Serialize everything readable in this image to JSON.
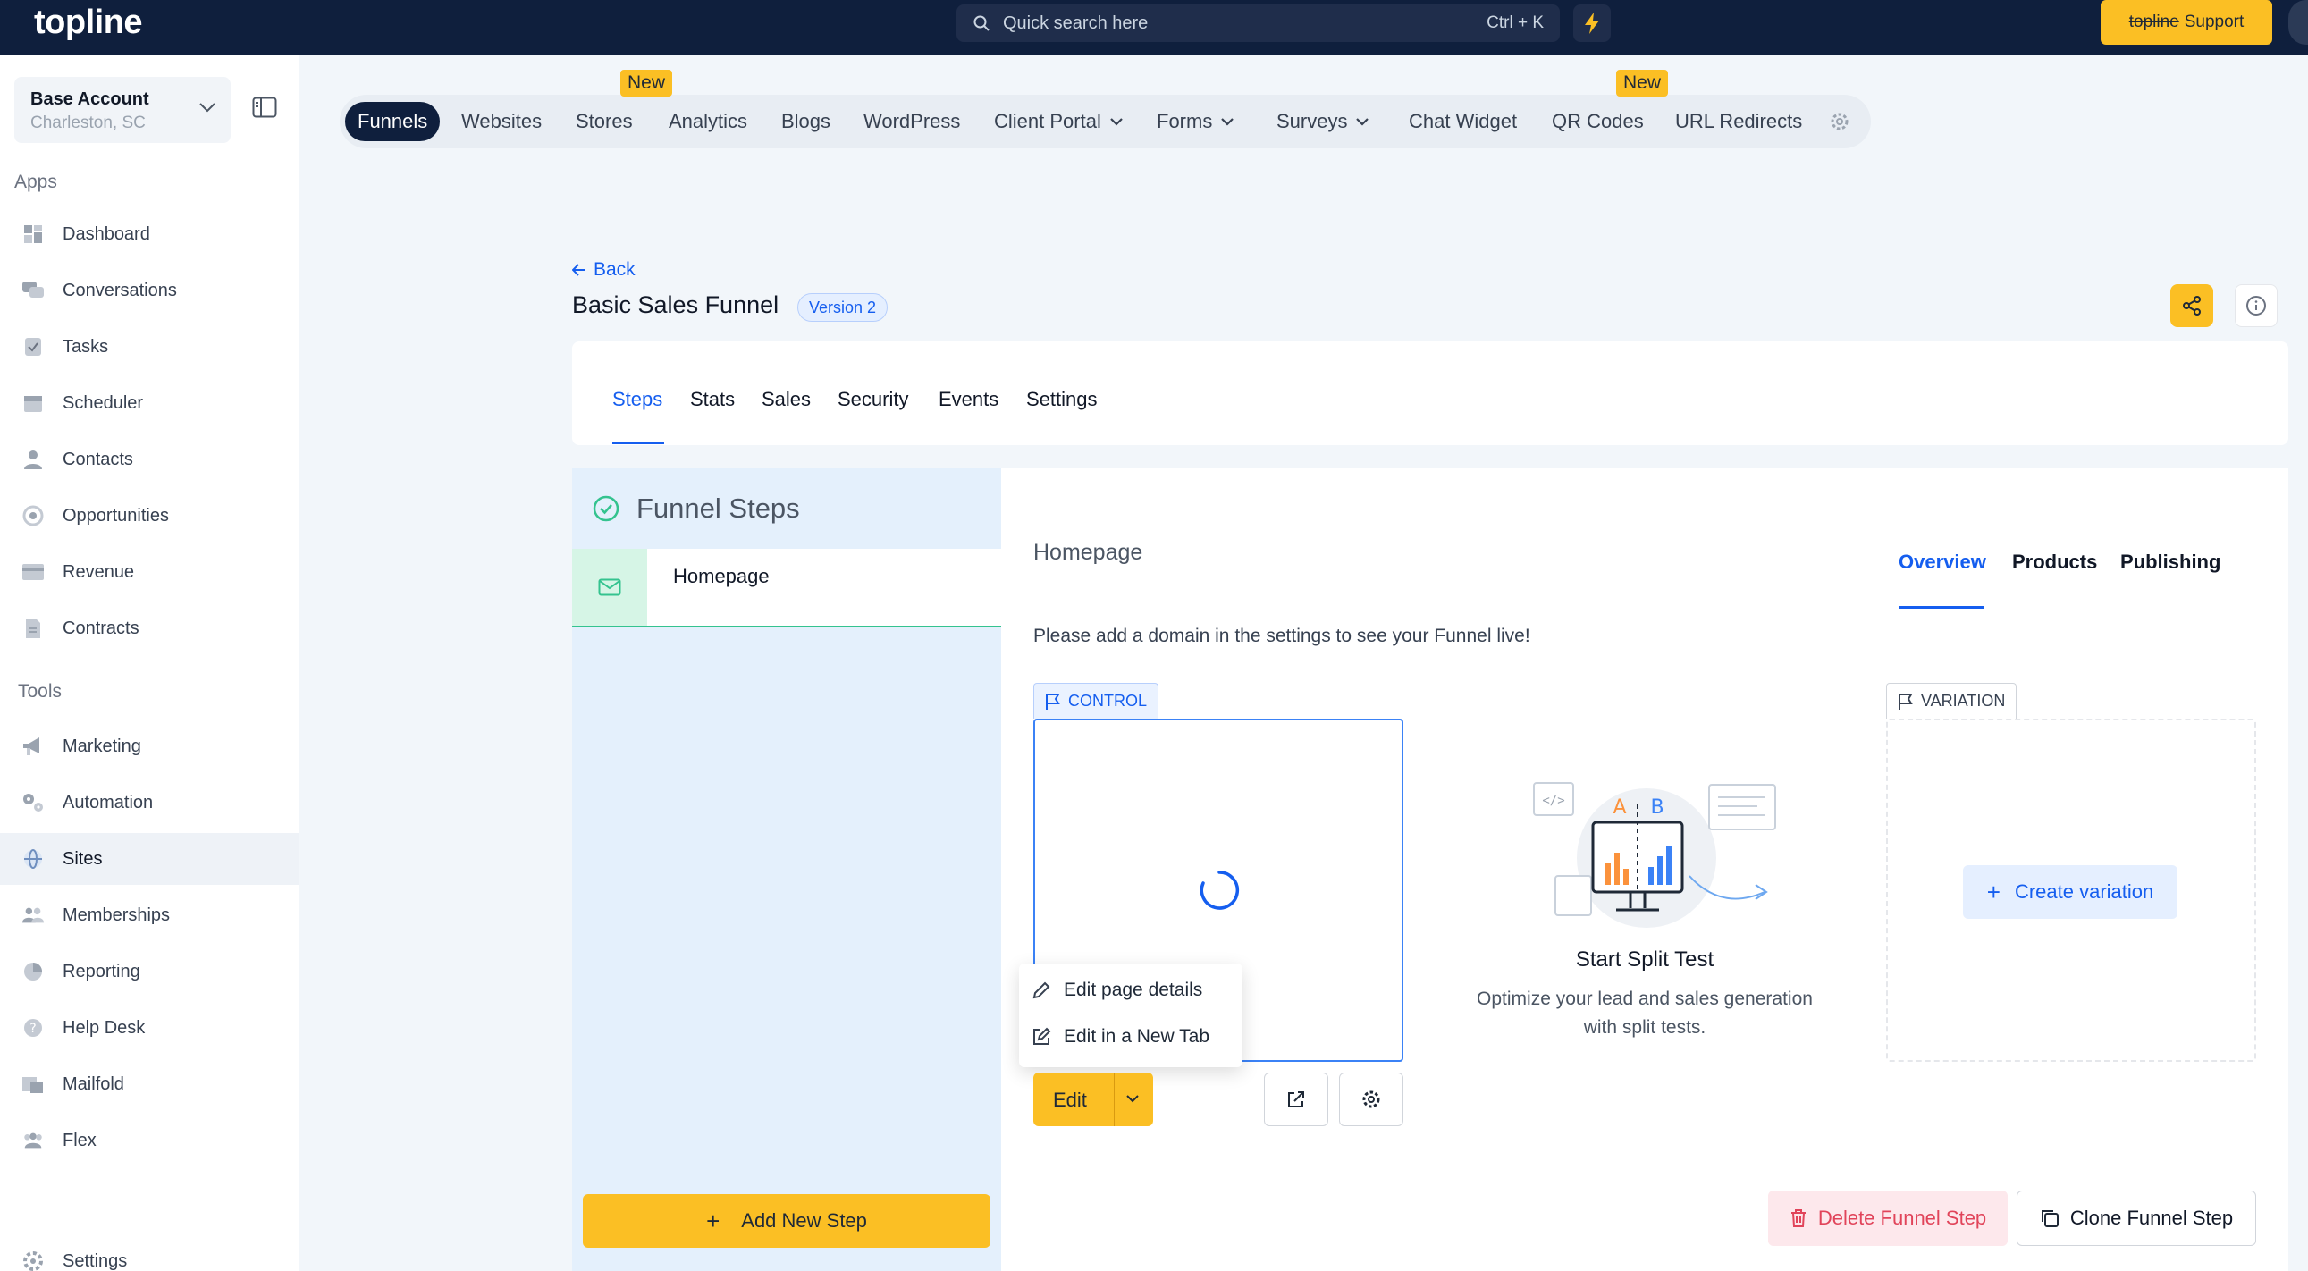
{
  "topbar": {
    "logo": "topline",
    "search_placeholder": "Quick search here",
    "search_shortcut": "Ctrl + K",
    "support_brand": "topline",
    "support_label": "Support"
  },
  "sidebar": {
    "account_name": "Base Account",
    "account_location": "Charleston, SC",
    "apps_title": "Apps",
    "apps": [
      {
        "label": "Dashboard",
        "icon": "dashboard-icon"
      },
      {
        "label": "Conversations",
        "icon": "chat-icon"
      },
      {
        "label": "Tasks",
        "icon": "tasks-icon"
      },
      {
        "label": "Scheduler",
        "icon": "calendar-icon"
      },
      {
        "label": "Contacts",
        "icon": "person-icon"
      },
      {
        "label": "Opportunities",
        "icon": "target-icon"
      },
      {
        "label": "Revenue",
        "icon": "card-icon"
      },
      {
        "label": "Contracts",
        "icon": "document-icon"
      }
    ],
    "tools_title": "Tools",
    "tools": [
      {
        "label": "Marketing",
        "icon": "megaphone-icon"
      },
      {
        "label": "Automation",
        "icon": "gears-icon"
      },
      {
        "label": "Sites",
        "icon": "globe-icon"
      },
      {
        "label": "Memberships",
        "icon": "members-icon"
      },
      {
        "label": "Reporting",
        "icon": "pie-icon"
      },
      {
        "label": "Help Desk",
        "icon": "help-icon"
      },
      {
        "label": "Mailfold",
        "icon": "mail-icon"
      },
      {
        "label": "Flex",
        "icon": "group-icon"
      }
    ],
    "settings_label": "Settings"
  },
  "app_tabs": {
    "items": [
      "Funnels",
      "Websites",
      "Stores",
      "Analytics",
      "Blogs",
      "WordPress",
      "Client Portal",
      "Forms",
      "Surveys",
      "Chat Widget",
      "QR Codes",
      "URL Redirects"
    ],
    "new_badge": "New"
  },
  "page": {
    "back_label": "Back",
    "title": "Basic Sales Funnel",
    "version": "Version 2"
  },
  "funnel_tabs": [
    "Steps",
    "Stats",
    "Sales",
    "Security",
    "Events",
    "Settings"
  ],
  "steps_panel": {
    "title": "Funnel Steps",
    "steps": [
      {
        "label": "Homepage"
      }
    ],
    "add_step_label": "Add New Step"
  },
  "step_detail": {
    "page_name": "Homepage",
    "subtabs": [
      "Overview",
      "Products",
      "Publishing"
    ],
    "domain_message": "Please add a domain in the settings to see your Funnel live!",
    "control_label": "CONTROL",
    "variation_label": "VARIATION",
    "create_variation_label": "Create variation",
    "split_test_title": "Start Split Test",
    "split_test_desc_line1": "Optimize your lead and sales generation",
    "split_test_desc_line2": "with split tests.",
    "split_a": "A",
    "split_b": "B",
    "edit_label": "Edit",
    "dropdown": [
      "Edit page details",
      "Edit in a New Tab"
    ],
    "delete_label": "Delete Funnel Step",
    "clone_label": "Clone Funnel Step"
  },
  "colors": {
    "topbar": "#0f1f3d",
    "accent_yellow": "#fbbf24",
    "link_blue": "#155eef",
    "steps_panel_bg": "#e4f0fc",
    "success_green": "#34c38f",
    "danger_red": "#e1445a"
  }
}
